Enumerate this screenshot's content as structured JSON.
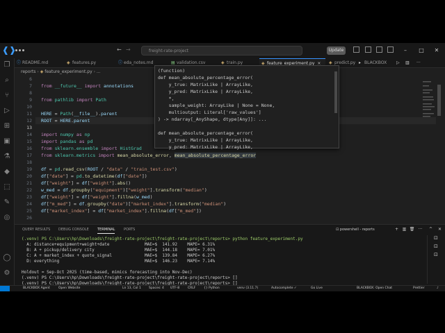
{
  "titlebar": {
    "search": "freight-rate-project",
    "update": "Update"
  },
  "tabs": [
    {
      "label": "README.md",
      "close": ""
    },
    {
      "label": "features.py",
      "close": ""
    },
    {
      "label": "eda_notes.md",
      "close": ""
    },
    {
      "label": "validation.csv",
      "close": ""
    },
    {
      "label": "train.py",
      "close": ""
    },
    {
      "label": "feature_experiment.py",
      "close": "×"
    },
    {
      "label": "predict.py",
      "close": ""
    },
    {
      "label": "BLACKBOX",
      "close": ""
    }
  ],
  "breadcrumb": {
    "folder": "reports",
    "file": "feature_experiment.py",
    "symbol": "..."
  },
  "editor": {
    "lines": [
      "6",
      "7",
      "8",
      "9",
      "10",
      "11",
      "12",
      "13",
      "14",
      "15",
      "16",
      "17",
      "18",
      "19",
      "20",
      "21",
      "22",
      "23",
      "24",
      "25",
      "26"
    ],
    "current_line": "13"
  },
  "hover": {
    "lines": [
      "(function)",
      "def mean_absolute_percentage_error(",
      "    y_true: MatrixLike | ArrayLike,",
      "    y_pred: MatrixLike | ArrayLike,",
      "    *,",
      "    sample_weight: ArrayLike | None = None,",
      "    multioutput: Literal['raw_values']",
      ") -> ndarray[_AnyShape, dtype[Any]]: ...",
      "",
      "def mean_absolute_percentage_error(",
      "    y_true: MatrixLike | ArrayLike,",
      "    y_pred: MatrixLike | ArrayLike,"
    ]
  },
  "panel": {
    "tabs": [
      "QUERY RESULTS",
      "DEBUG CONSOLE",
      "TERMINAL",
      "PORTS"
    ],
    "terminal_name": "powershell - reports",
    "lines": [
      "(.venv) PS C:\\Users\\hp\\Downloads\\freight-rate-project\\freight-rate-project\\reports> python feature_experiment.py",
      "  A: distance+equipment+weight+date              MAE=$  141.92    MAPE= 6.31%",
      "  B: A + pickup/delivery city                    MAE=$  144.18    MAPE= 7.01%",
      "  C: A + market_index + quote_signal             MAE=$  139.84    MAPE= 6.27%",
      "  D: everything                                  MAE=$  146.23    MAPE= 7.14%",
      "",
      "Holdout = Sep-Oct 2025 (time-based, mimics forecasting into Nov-Dec)",
      "(.venv) PS C:\\Users\\hp\\Downloads\\freight-rate-project\\freight-rate-project\\reports> []",
      "(.venv) PS C:\\Users\\hp\\Downloads\\freight-rate-project\\freight-rate-project\\reports> []"
    ]
  },
  "statusbar": {
    "items": [
      "BLACKBOX Agent",
      "Open Website",
      "Ln 13, Col 1",
      "Spaces: 4",
      "UTF-8",
      "CRLF",
      "{} Python",
      "venv (3.11.7)",
      "Autocomplete ✓",
      "Go Live",
      "BLACKBOX: Open Chat",
      "Prettier"
    ]
  }
}
